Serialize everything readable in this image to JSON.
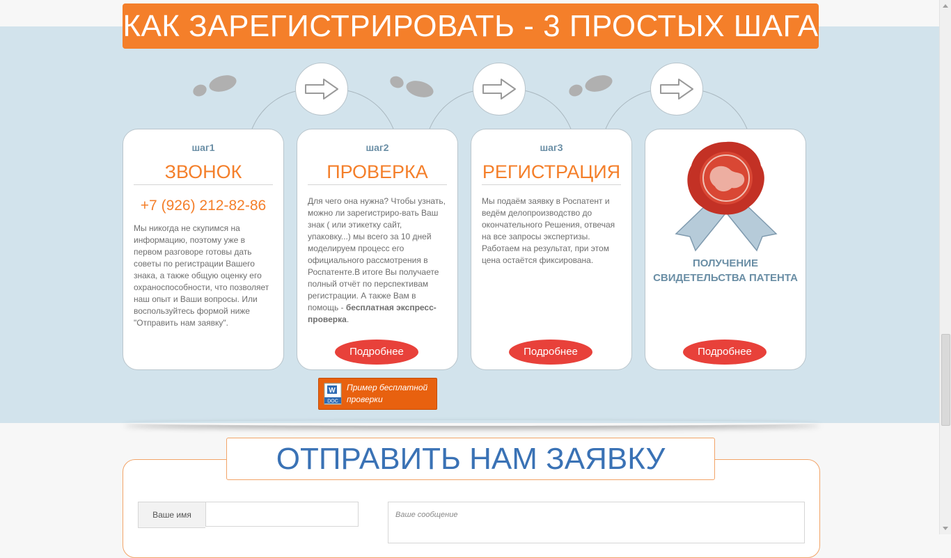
{
  "headline": "КАК ЗАРЕГИСТРИРОВАТЬ - 3 ПРОСТЫХ ШАГА",
  "steps": [
    {
      "label": "шаг1",
      "title": "ЗВОНОК",
      "phone": "+7 (926) 212-82-86",
      "text": "Мы никогда не скупимся на информацию, поэтому уже в первом разговоре готовы дать советы по регистрации Вашего знака,  а также общую оценку его охраноспособности, что позволяет наш опыт и Ваши вопросы. Или воспользуйтесь формой ниже \"Отправить нам заявку\"."
    },
    {
      "label": "шаг2",
      "title": "ПРОВЕРКА",
      "text_main": "Для чего она нужна? Чтобы узнать, можно ли зарегистриро-вать Ваш знак ( или этикетку  сайт, упаковку...) мы всего за 10 дней моделируем процесс его официального рассмотрения в Роспатенте.В итоге Вы получаете полный отчёт по перспективам регистрации. А также Вам в помощь - ",
      "text_bold": "бесплатная экспресс-проверка",
      "text_end": ".",
      "button": "Подробнее"
    },
    {
      "label": "шаг3",
      "title": "РЕГИСТРАЦИЯ",
      "text": "Мы подаём заявку в Роспатент и ведём делопроизводство до окончательного Решения, отвечая на все запросы экспертизы. Работаем на результат, при этом  цена остаётся фиксирована.",
      "button": "Подробнее"
    },
    {
      "title_line1": "ПОЛУЧЕНИЕ",
      "title_line2": "СВИДЕТЕЛЬСТВА ПАТЕНТА",
      "button": "Подробнее"
    }
  ],
  "doc_button": {
    "icon_text": "DOC",
    "line1": "Пример бесплатной",
    "line2": "проверки"
  },
  "form": {
    "title": "ОТПРАВИТЬ НАМ ЗАЯВКУ",
    "name_label": "Ваше имя",
    "message_placeholder": "Ваше сообщение"
  },
  "colors": {
    "accent_orange": "#f47f2a",
    "button_red": "#e8413a",
    "band_blue": "#d2e3ec",
    "title_blue": "#3a72b5"
  }
}
